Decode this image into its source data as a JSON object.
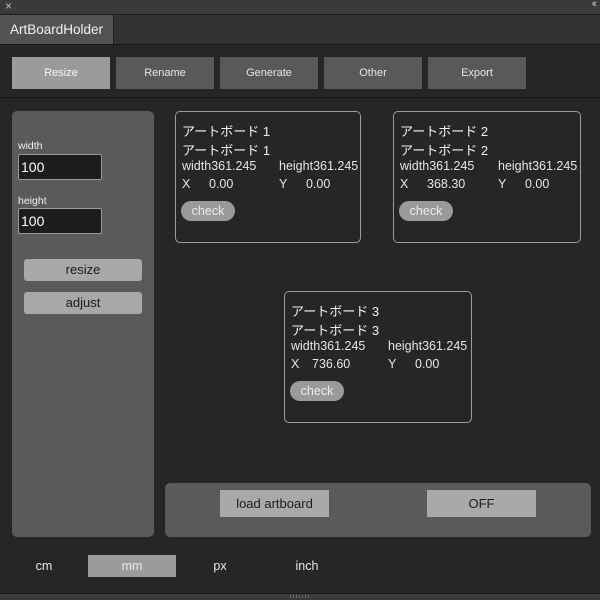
{
  "window": {
    "close_glyph": "×",
    "collapse_glyph": "‹‹"
  },
  "panel": {
    "tab_title": "ArtBoardHolder"
  },
  "menu": {
    "items": [
      "Resize",
      "Rename",
      "Generate",
      "Other",
      "Export"
    ],
    "active_index": 0
  },
  "size_form": {
    "width_label": "width",
    "width_value": "100",
    "height_label": "height",
    "height_value": "100",
    "resize_label": "resize",
    "adjust_label": "adjust"
  },
  "artboards": [
    {
      "name": "アートボード 1",
      "name2": "アートボード 1",
      "width_label": "width",
      "width": "361.245",
      "height_label": "height",
      "height": "361.245",
      "x_label": "X",
      "x": "0.00",
      "y_label": "Y",
      "y": "0.00",
      "check_label": "check"
    },
    {
      "name": "アートボード 2",
      "name2": "アートボード 2",
      "width_label": "width",
      "width": "361.245",
      "height_label": "height",
      "height": "361.245",
      "x_label": "X",
      "x": "368.30",
      "y_label": "Y",
      "y": "0.00",
      "check_label": "check"
    },
    {
      "name": "アートボード 3",
      "name2": "アートボード 3",
      "width_label": "width",
      "width": "361.245",
      "height_label": "height",
      "height": "361.245",
      "x_label": "X",
      "x": "736.60",
      "y_label": "Y",
      "y": "0.00",
      "check_label": "check"
    }
  ],
  "actions": {
    "load_label": "load artboard",
    "toggle_label": "OFF"
  },
  "units": {
    "items": [
      "cm",
      "mm",
      "px",
      "inch"
    ],
    "active_index": 1
  },
  "colors": {
    "active_button": "#9b9b9b",
    "panel": "#5a5a5a",
    "background": "#262626"
  }
}
